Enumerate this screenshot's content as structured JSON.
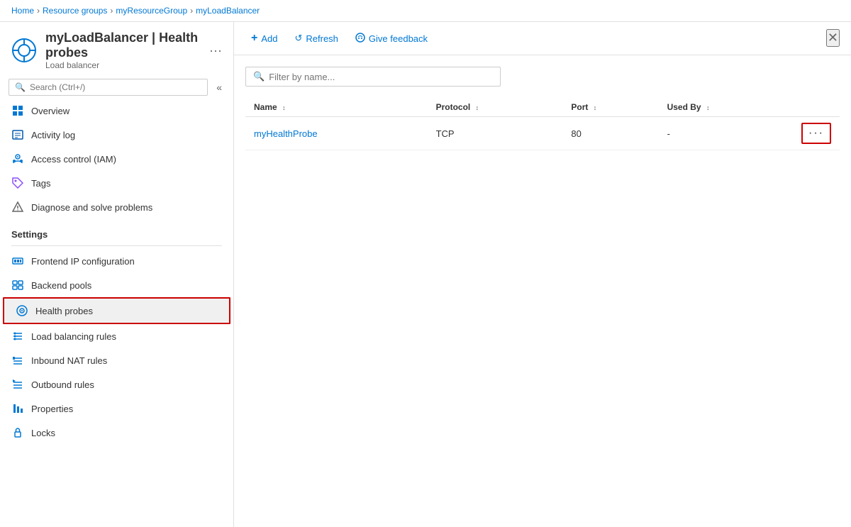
{
  "breadcrumb": {
    "items": [
      "Home",
      "Resource groups",
      "myResourceGroup",
      "myLoadBalancer"
    ]
  },
  "header": {
    "title": "myLoadBalancer | Health probes",
    "subtitle": "Load balancer",
    "more_label": "···"
  },
  "search": {
    "placeholder": "Search (Ctrl+/)"
  },
  "sidebar": {
    "collapse_icon": "«",
    "nav_items": [
      {
        "id": "overview",
        "label": "Overview",
        "icon": "overview"
      },
      {
        "id": "activity-log",
        "label": "Activity log",
        "icon": "activity"
      },
      {
        "id": "access-control",
        "label": "Access control (IAM)",
        "icon": "access"
      },
      {
        "id": "tags",
        "label": "Tags",
        "icon": "tags"
      },
      {
        "id": "diagnose",
        "label": "Diagnose and solve problems",
        "icon": "diagnose"
      }
    ],
    "settings_label": "Settings",
    "settings_items": [
      {
        "id": "frontend-ip",
        "label": "Frontend IP configuration",
        "icon": "frontend"
      },
      {
        "id": "backend-pools",
        "label": "Backend pools",
        "icon": "backend"
      },
      {
        "id": "health-probes",
        "label": "Health probes",
        "icon": "health",
        "active": true
      },
      {
        "id": "lb-rules",
        "label": "Load balancing rules",
        "icon": "lbrules"
      },
      {
        "id": "inbound-nat",
        "label": "Inbound NAT rules",
        "icon": "inbound"
      },
      {
        "id": "outbound-rules",
        "label": "Outbound rules",
        "icon": "outbound"
      },
      {
        "id": "properties",
        "label": "Properties",
        "icon": "properties"
      },
      {
        "id": "locks",
        "label": "Locks",
        "icon": "locks"
      }
    ]
  },
  "toolbar": {
    "add_label": "Add",
    "refresh_label": "Refresh",
    "feedback_label": "Give feedback"
  },
  "filter": {
    "placeholder": "Filter by name..."
  },
  "table": {
    "columns": [
      "Name",
      "Protocol",
      "Port",
      "Used By"
    ],
    "rows": [
      {
        "name": "myHealthProbe",
        "protocol": "TCP",
        "port": "80",
        "used_by": "-"
      }
    ]
  }
}
